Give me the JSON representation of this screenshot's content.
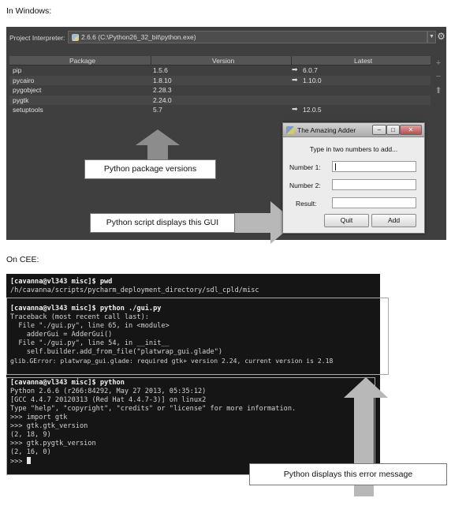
{
  "headings": {
    "windows": "In Windows:",
    "cee": "On CEE:"
  },
  "ide": {
    "interpreter_label": "Project Interpreter:",
    "interpreter_value": "2.6.6 (C:\\Python26_32_bit\\python.exe)",
    "columns": {
      "package": "Package",
      "version": "Version",
      "latest": "Latest"
    },
    "packages": [
      {
        "name": "pip",
        "version": "1.5.6",
        "upgrade": true,
        "latest": "6.0.7"
      },
      {
        "name": "pycairo",
        "version": "1.8.10",
        "upgrade": true,
        "latest": "1.10.0"
      },
      {
        "name": "pygobject",
        "version": "2.28.3",
        "upgrade": false,
        "latest": ""
      },
      {
        "name": "pygtk",
        "version": "2.24.0",
        "upgrade": false,
        "latest": ""
      },
      {
        "name": "setuptools",
        "version": "5.7",
        "upgrade": true,
        "latest": "12.0.5"
      }
    ],
    "side_icons": [
      "plus-icon",
      "minus-icon",
      "upgrade-arrow-icon"
    ]
  },
  "dialog": {
    "title": "The Amazing Adder",
    "prompt": "Type in two numbers to add...",
    "number1_label": "Number 1:",
    "number2_label": "Number 2:",
    "result_label": "Result:",
    "number1_value": "",
    "number2_value": "",
    "result_value": "",
    "quit_label": "Quit",
    "add_label": "Add",
    "win_minimize": "–",
    "win_maximize": "□",
    "win_close": "✕"
  },
  "callouts": {
    "package_versions": "Python package versions",
    "script_gui": "Python script displays this GUI",
    "error_message": "Python displays this error message"
  },
  "terminal": {
    "lines": [
      "[cavanna@vl343 misc]$ pwd",
      "/h/cavanna/scripts/pycharm_deployment_directory/sdl_cpld/misc",
      "",
      "[cavanna@vl343 misc]$ python ./gui.py",
      "Traceback (most recent call last):",
      "  File \"./gui.py\", line 65, in <module>",
      "    adderGui = AdderGui()",
      "  File \"./gui.py\", line 54, in __init__",
      "    self.builder.add_from_file(\"platwrap_gui.glade\")",
      "glib.GError: platwrap_gui.glade: required gtk+ version 2.24, current version is 2.18",
      "",
      "[cavanna@vl343 misc]$ python",
      "Python 2.6.6 (r266:84292, May 27 2013, 05:35:12)",
      "[GCC 4.4.7 20120313 (Red Hat 4.4.7-3)] on linux2",
      "Type \"help\", \"copyright\", \"credits\" or \"license\" for more information.",
      ">>> import gtk",
      ">>> gtk.gtk_version",
      "(2, 18, 9)",
      ">>> gtk.pygtk_version",
      "(2, 16, 0)",
      ">>> "
    ]
  },
  "colors": {
    "ide_bg": "#3f3f3f",
    "terminal_bg": "#151515",
    "arrow_gray": "#8c8c8c"
  }
}
